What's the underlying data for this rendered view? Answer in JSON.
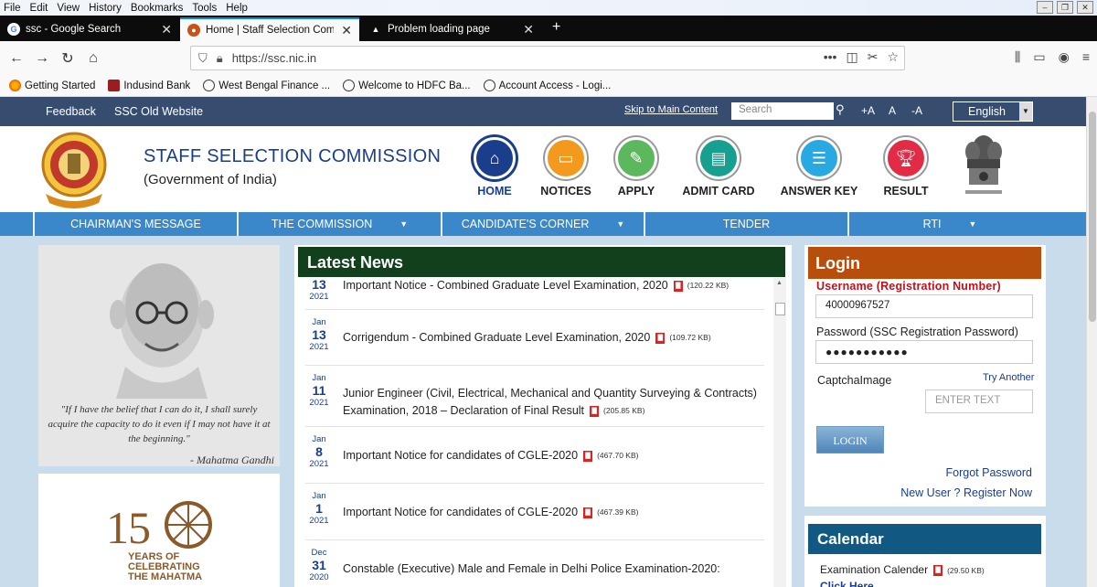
{
  "browser": {
    "menu": [
      "File",
      "Edit",
      "View",
      "History",
      "Bookmarks",
      "Tools",
      "Help"
    ],
    "tabs": [
      {
        "title": "ssc - Google Search",
        "icon": "google-icon"
      },
      {
        "title": "Home | Staff Selection Commis",
        "icon": "ssc-favicon-icon"
      },
      {
        "title": "Problem loading page",
        "icon": "warning-icon"
      }
    ],
    "url": "https://ssc.nic.in",
    "bookmarks": [
      "Getting Started",
      "Indusind Bank",
      "West Bengal Finance ...",
      "Welcome to HDFC Ba...",
      "Account Access - Logi..."
    ]
  },
  "topstrip": {
    "feedback": "Feedback",
    "old_site": "SSC Old Website",
    "skip": "Skip to Main Content",
    "search_placeholder": "Search",
    "font_plus": "+A",
    "font_normal": "A",
    "font_minus": "-A",
    "language": "English"
  },
  "header": {
    "org_name": "STAFF SELECTION COMMISSION",
    "org_sub": "(Government of India)",
    "nav": [
      {
        "label": "HOME",
        "color": "#1b3e8c",
        "icon": "home-icon"
      },
      {
        "label": "NOTICES",
        "color": "#f39a1e",
        "icon": "notices-icon"
      },
      {
        "label": "APPLY",
        "color": "#5cb85c",
        "icon": "apply-icon"
      },
      {
        "label": "ADMIT CARD",
        "color": "#17a08f",
        "icon": "admit-card-icon"
      },
      {
        "label": "ANSWER KEY",
        "color": "#29a9e1",
        "icon": "answer-key-icon"
      },
      {
        "label": "RESULT",
        "color": "#e22b45",
        "icon": "trophy-icon"
      }
    ]
  },
  "mainnav": [
    "CHAIRMAN'S MESSAGE",
    "THE COMMISSION",
    "CANDIDATE'S CORNER",
    "TENDER",
    "RTI"
  ],
  "quote": {
    "text": "\"If I have the belief that I can do it, I shall surely acquire the capacity to do it even if I may not have it at the beginning.\"",
    "author": "- Mahatma Gandhi"
  },
  "logo150": {
    "line1": "YEARS OF",
    "line2": "CELEBRATING",
    "line3": "THE MAHATMA"
  },
  "news": {
    "title": "Latest News",
    "items": [
      {
        "month": "",
        "day": "13",
        "year": "2021",
        "text": "Important Notice - Combined Graduate Level Examination, 2020",
        "size": "(120.22 KB)"
      },
      {
        "month": "Jan",
        "day": "13",
        "year": "2021",
        "text": "Corrigendum - Combined Graduate Level Examination, 2020",
        "size": "(109.72 KB)"
      },
      {
        "month": "Jan",
        "day": "11",
        "year": "2021",
        "text": "Junior Engineer (Civil, Electrical, Mechanical and Quantity Surveying & Contracts) Examination, 2018 – Declaration of Final Result",
        "size": "(205.85 KB)"
      },
      {
        "month": "Jan",
        "day": "8",
        "year": "2021",
        "text": "Important Notice for candidates of CGLE-2020",
        "size": "(467.70 KB)"
      },
      {
        "month": "Jan",
        "day": "1",
        "year": "2021",
        "text": "Important Notice for candidates of CGLE-2020",
        "size": "(467.39 KB)"
      },
      {
        "month": "Dec",
        "day": "31",
        "year": "2020",
        "text": "Constable (Executive) Male and Female in Delhi Police Examination-2020:",
        "size": ""
      }
    ]
  },
  "login": {
    "title": "Login",
    "username_label": "Username (Registration Number)",
    "username_value": "40000967527",
    "password_label": "Password (SSC Registration Password)",
    "password_value": "●●●●●●●●●●●",
    "captcha_label": "CaptchaImage",
    "try_another": "Try Another",
    "captcha_placeholder": "ENTER TEXT",
    "button": "LOGIN",
    "forgot": "Forgot Password",
    "new_user": "New User ? Register Now"
  },
  "calendar": {
    "title": "Calendar",
    "item": "Examination Calender",
    "size": "(29.50 KB)",
    "click": "Click Here"
  }
}
